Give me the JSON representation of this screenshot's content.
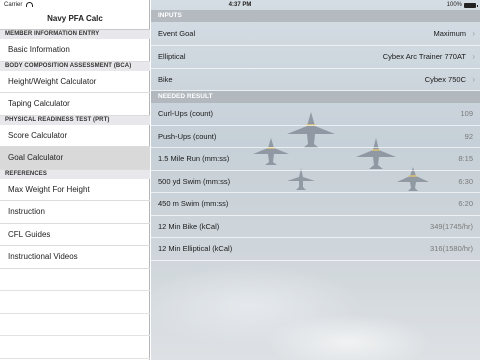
{
  "status": {
    "carrier": "Carrier",
    "time": "4:37 PM",
    "battery": "100%"
  },
  "sidebar": {
    "title": "Navy PFA Calc",
    "sections": [
      {
        "header": "MEMBER INFORMATION ENTRY",
        "items": [
          "Basic Information"
        ]
      },
      {
        "header": "BODY COMPOSITION ASSESSMENT (BCA)",
        "items": [
          "Height/Weight Calculator",
          "Taping Calculator"
        ]
      },
      {
        "header": "PHYSICAL READINESS TEST (PRT)",
        "items": [
          "Score Calculator",
          "Goal Calculator"
        ]
      },
      {
        "header": "REFERENCES",
        "items": [
          "Max Weight For Height",
          "Instruction",
          "CFL Guides",
          "Instructional Videos"
        ]
      }
    ],
    "selected_item": "Goal Calculator"
  },
  "main": {
    "inputs_header": "INPUTS",
    "inputs": [
      {
        "label": "Event Goal",
        "value": "Maximum"
      },
      {
        "label": "Elliptical",
        "value": "Cybex Arc Trainer 770AT"
      },
      {
        "label": "Bike",
        "value": "Cybex 750C"
      }
    ],
    "results_header": "NEEDED RESULT",
    "results": [
      {
        "label": "Curl-Ups (count)",
        "value": "109"
      },
      {
        "label": "Push-Ups (count)",
        "value": "92"
      },
      {
        "label": "1.5 Mile Run (mm:ss)",
        "value": "8:15"
      },
      {
        "label": "500 yd Swim (mm:ss)",
        "value": "6:30"
      },
      {
        "label": "450 m Swim (mm:ss)",
        "value": "6:20"
      },
      {
        "label": "12 Min Bike (kCal)",
        "value": "349(1745/hr)"
      },
      {
        "label": "12 Min Elliptical (kCal)",
        "value": "316(1580/hr)"
      }
    ]
  },
  "icons": {
    "chevron": "chevron-right-icon",
    "wifi": "wifi-icon",
    "battery": "battery-icon"
  }
}
